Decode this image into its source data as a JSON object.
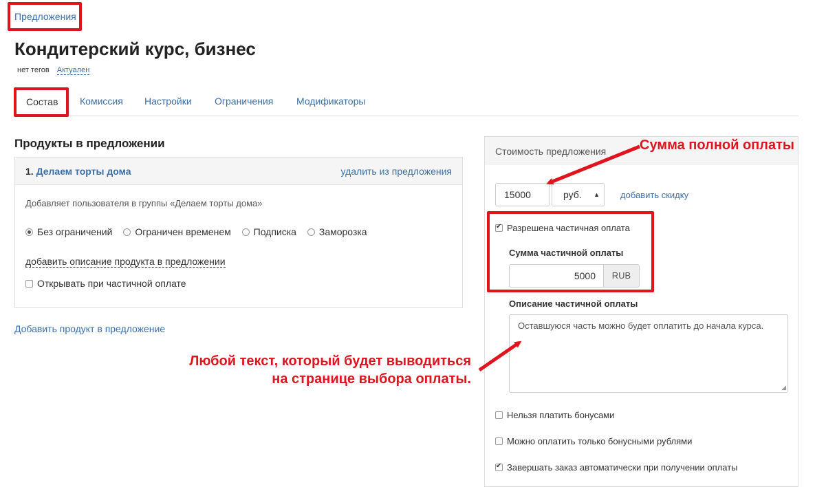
{
  "breadcrumb": {
    "label": "Предложения"
  },
  "page": {
    "title": "Кондитерский курс, бизнес",
    "tags": "нет тегов",
    "status": "Актуален"
  },
  "tabs": [
    {
      "label": "Состав",
      "active": true
    },
    {
      "label": "Комиссия"
    },
    {
      "label": "Настройки"
    },
    {
      "label": "Ограничения"
    },
    {
      "label": "Модификаторы"
    }
  ],
  "products": {
    "section_title": "Продукты в предложении",
    "item": {
      "number": "1.",
      "name": "Делаем торты дома",
      "remove_label": "удалить из предложения",
      "description": "Добавляет пользователя в группы «Делаем торты дома»",
      "access_options": [
        {
          "label": "Без ограничений",
          "selected": true
        },
        {
          "label": "Ограничен временем",
          "selected": false
        },
        {
          "label": "Подписка",
          "selected": false
        },
        {
          "label": "Заморозка",
          "selected": false
        }
      ],
      "add_description_label": "добавить описание продукта в предложении",
      "open_on_partial_label": "Открывать при частичной оплате",
      "open_on_partial_checked": false
    },
    "add_product_label": "Добавить продукт в предложение"
  },
  "pricing": {
    "header": "Стоимость предложения",
    "price_value": "15000",
    "currency_selected": "руб.",
    "add_discount_label": "добавить скидку",
    "partial_allowed_label": "Разрешена частичная оплата",
    "partial_allowed_checked": true,
    "partial_sum_label": "Сумма частичной оплаты",
    "partial_sum_value": "5000",
    "partial_sum_currency": "RUB",
    "partial_desc_label": "Описание частичной оплаты",
    "partial_desc_value": "Оставшуюся часть можно будет оплатить до начала курса.",
    "options": [
      {
        "label": "Нельзя платить бонусами",
        "checked": false
      },
      {
        "label": "Можно оплатить только бонусными рублями",
        "checked": false
      },
      {
        "label": "Завершать заказ автоматически при получении оплаты",
        "checked": true
      }
    ]
  },
  "annotations": {
    "full_payment": "Сумма полной оплаты",
    "any_text_line1": "Любой текст, который будет выводиться",
    "any_text_line2": "на странице выбора оплаты."
  },
  "colors": {
    "accent_link": "#3a6fa8",
    "highlight_red": "#e0141e"
  }
}
